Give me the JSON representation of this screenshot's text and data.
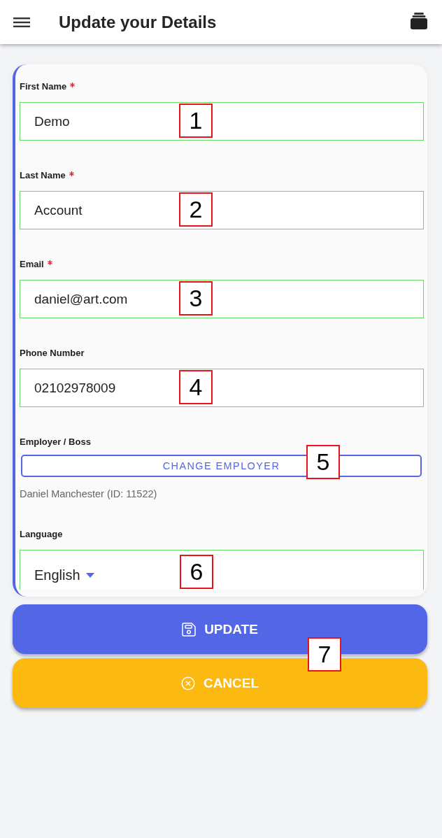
{
  "header": {
    "title": "Update your Details"
  },
  "form": {
    "fields": [
      {
        "kind": "text",
        "label": "First Name",
        "required": true,
        "value": "Demo",
        "marker": "1"
      },
      {
        "kind": "text",
        "label": "Last Name",
        "required": true,
        "value": "Account",
        "marker": "2"
      },
      {
        "kind": "text",
        "label": "Email",
        "required": true,
        "value": "daniel@art.com",
        "marker": "3"
      },
      {
        "kind": "text",
        "label": "Phone Number",
        "required": false,
        "value": "02102978009",
        "marker": "4"
      },
      {
        "kind": "employer",
        "label": "Employer / Boss",
        "required": false,
        "button": "CHANGE EMPLOYER",
        "note": "Daniel Manchester (ID: 11522)",
        "marker": "5"
      },
      {
        "kind": "select",
        "label": "Language",
        "required": false,
        "value": "English",
        "marker": "6"
      }
    ]
  },
  "actions": {
    "buttons": [
      {
        "kind": "update",
        "label": "UPDATE"
      },
      {
        "kind": "cancel",
        "label": "CANCEL"
      }
    ],
    "marker": "7"
  }
}
